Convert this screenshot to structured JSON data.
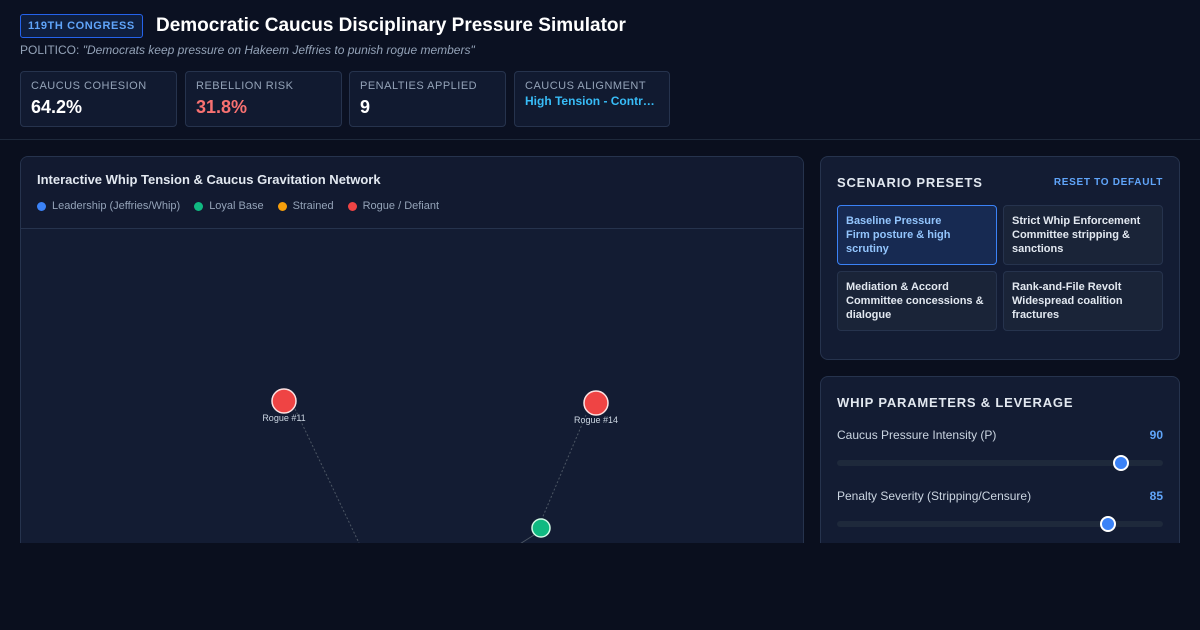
{
  "header": {
    "badge": "119TH CONGRESS",
    "title": "Democratic Caucus Disciplinary Pressure Simulator",
    "source_prefix": "POLITICO:",
    "source_quote": "\"Democrats keep pressure on Hakeem Jeffries to punish rogue members\""
  },
  "metrics": [
    {
      "label": "Caucus Cohesion",
      "value": "64.2%"
    },
    {
      "label": "Rebellion Risk",
      "value": "31.8%"
    },
    {
      "label": "Penalties Applied",
      "value": "9"
    },
    {
      "label": "Caucus Alignment",
      "value": "High Tension - Controlled"
    }
  ],
  "network": {
    "title": "Interactive Whip Tension & Caucus Gravitation Network",
    "legend": [
      {
        "label": "Leadership (Jeffries/Whip)",
        "color": "#3b82f6"
      },
      {
        "label": "Loyal Base",
        "color": "#10b981"
      },
      {
        "label": "Strained",
        "color": "#f59e0b"
      },
      {
        "label": "Rogue / Defiant",
        "color": "#ef4444"
      }
    ],
    "nodes": [
      {
        "id": "r11",
        "label": "Rogue #11",
        "group": "rogue",
        "color": "#ef4444"
      },
      {
        "id": "r14",
        "label": "Rogue #14",
        "group": "rogue",
        "color": "#ef4444"
      },
      {
        "id": "l1",
        "label": "",
        "group": "loyal",
        "color": "#10b981"
      }
    ]
  },
  "presets": {
    "title": "Scenario Presets",
    "reset_label": "RESET TO DEFAULT",
    "items": [
      {
        "name": "Baseline Pressure",
        "desc": "Firm posture & high scrutiny",
        "active": true
      },
      {
        "name": "Strict Whip Enforcement",
        "desc": "Committee stripping & sanctions",
        "active": false
      },
      {
        "name": "Mediation & Accord",
        "desc": "Committee concessions & dialogue",
        "active": false
      },
      {
        "name": "Rank-and-File Revolt",
        "desc": "Widespread coalition fractures",
        "active": false
      }
    ]
  },
  "whip": {
    "title": "Whip Parameters & Leverage",
    "params": [
      {
        "label": "Caucus Pressure Intensity (P)",
        "value": "90",
        "level": 0.87
      },
      {
        "label": "Penalty Severity (Stripping/Censure)",
        "value": "85",
        "level": 0.83
      }
    ]
  }
}
